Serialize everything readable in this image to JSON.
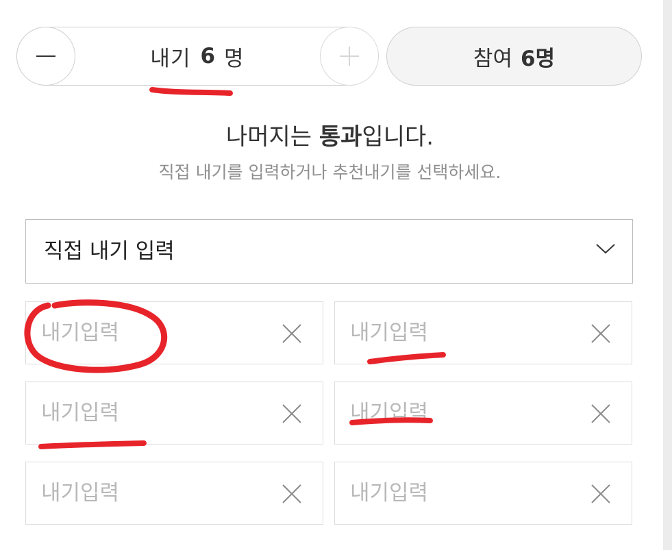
{
  "stepper": {
    "label_prefix": "내기",
    "count": "6",
    "label_suffix": "명",
    "minus_icon": "minus-icon",
    "plus_icon": "plus-icon"
  },
  "participants": {
    "label_prefix": "참여",
    "count": "6명"
  },
  "headline": {
    "pre": "나머지는 ",
    "bold": "통과",
    "post": "입니다."
  },
  "subline": "직접 내기를 입력하거나 추천내기를 선택하세요.",
  "select": {
    "value": "직접 내기 입력",
    "icon": "chevron-down-icon"
  },
  "fields": [
    {
      "placeholder": "내기입력",
      "value": ""
    },
    {
      "placeholder": "내기입력",
      "value": ""
    },
    {
      "placeholder": "내기입력",
      "value": ""
    },
    {
      "placeholder": "내기입력",
      "value": ""
    },
    {
      "placeholder": "내기입력",
      "value": ""
    },
    {
      "placeholder": "내기입력",
      "value": ""
    }
  ],
  "colors": {
    "annotation": "#e8242b",
    "border": "#dcdcdc",
    "placeholder": "#b8b8b8"
  }
}
